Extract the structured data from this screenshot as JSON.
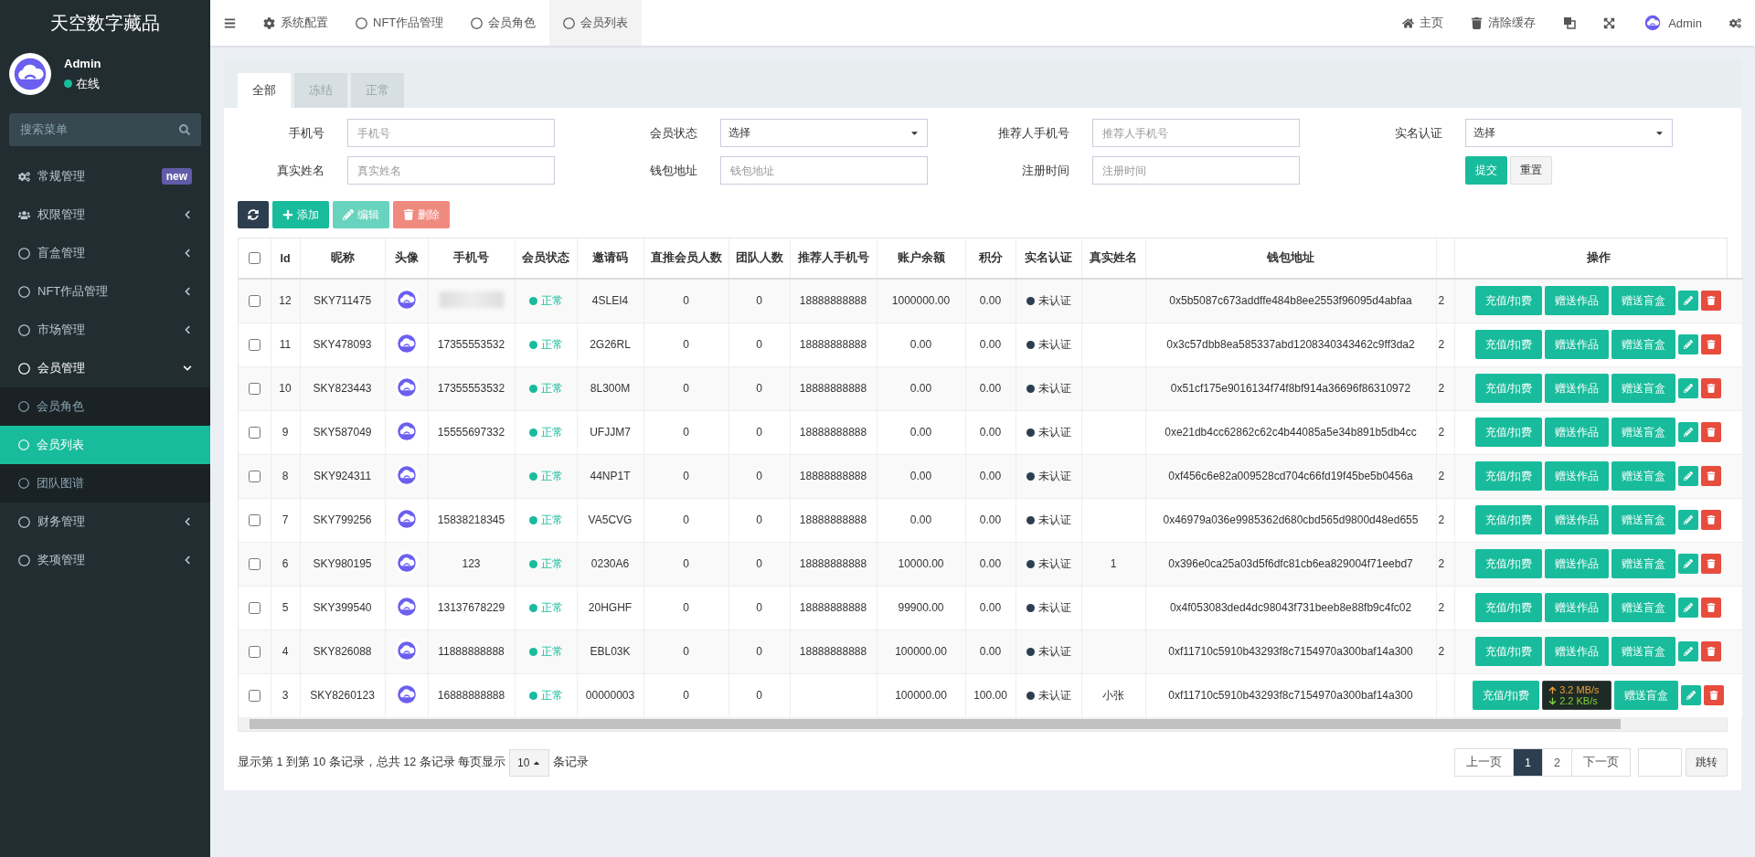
{
  "sidebar": {
    "brand": "天空数字藏品",
    "user": {
      "name": "Admin",
      "status": "在线"
    },
    "search": {
      "placeholder": "搜索菜单"
    },
    "items": [
      {
        "kind": "gears",
        "label": "常规管理",
        "badge": "new",
        "expanded": false,
        "selected": false
      },
      {
        "kind": "users",
        "label": "权限管理",
        "expanded": false,
        "selected": false
      },
      {
        "kind": "circle",
        "label": "盲盒管理",
        "expanded": false,
        "selected": false
      },
      {
        "kind": "circle",
        "label": "NFT作品管理",
        "expanded": false,
        "selected": false
      },
      {
        "kind": "circle",
        "label": "市场管理",
        "expanded": false,
        "selected": false
      },
      {
        "kind": "circle",
        "label": "会员管理",
        "expanded": true,
        "selected": false,
        "children": [
          {
            "label": "会员角色",
            "selected": false
          },
          {
            "label": "会员列表",
            "selected": true
          },
          {
            "label": "团队图谱",
            "selected": false
          }
        ]
      },
      {
        "kind": "circle",
        "label": "财务管理",
        "expanded": false,
        "selected": false
      },
      {
        "kind": "circle",
        "label": "奖项管理",
        "expanded": false,
        "selected": false
      }
    ]
  },
  "topbar": {
    "tabs": [
      {
        "kind": "gear",
        "label": "系统配置",
        "selected": false
      },
      {
        "kind": "circle",
        "label": "NFT作品管理",
        "selected": false
      },
      {
        "kind": "circle",
        "label": "会员角色",
        "selected": false
      },
      {
        "kind": "circle",
        "label": "会员列表",
        "selected": true
      }
    ],
    "right": [
      {
        "kind": "home",
        "label": "主页"
      },
      {
        "kind": "trash",
        "label": "清除缓存"
      },
      {
        "kind": "translate"
      },
      {
        "kind": "fullscreen"
      },
      {
        "kind": "user",
        "label": "Admin"
      },
      {
        "kind": "settings"
      }
    ]
  },
  "filter_tabs": [
    {
      "label": "全部",
      "selected": true
    },
    {
      "label": "冻结",
      "selected": false
    },
    {
      "label": "正常",
      "selected": false
    }
  ],
  "filters": [
    {
      "kind": "text",
      "label": "手机号",
      "placeholder": "手机号"
    },
    {
      "kind": "select",
      "label": "会员状态",
      "value": "选择"
    },
    {
      "kind": "text",
      "label": "推荐人手机号",
      "placeholder": "推荐人手机号"
    },
    {
      "kind": "select",
      "label": "实名认证",
      "value": "选择"
    },
    {
      "kind": "text",
      "label": "真实姓名",
      "placeholder": "真实姓名"
    },
    {
      "kind": "text",
      "label": "钱包地址",
      "placeholder": "钱包地址"
    },
    {
      "kind": "text",
      "label": "注册时间",
      "placeholder": "注册时间"
    }
  ],
  "filter_buttons": [
    "提交",
    "重置"
  ],
  "toolbar": [
    {
      "kind": "refresh",
      "disabled": false
    },
    {
      "kind": "add",
      "label": "添加",
      "disabled": false
    },
    {
      "kind": "edit",
      "label": "编辑",
      "disabled": true
    },
    {
      "kind": "delete",
      "label": "删除",
      "disabled": true
    }
  ],
  "table": {
    "select_all_checked": false,
    "columns": [
      "Id",
      "昵称",
      "头像",
      "手机号",
      "会员状态",
      "邀请码",
      "直推会员人数",
      "团队人数",
      "推荐人手机号",
      "账户余额",
      "积分",
      "实名认证",
      "真实姓名",
      "钱包地址",
      "操作"
    ],
    "rows": [
      {
        "checked": false,
        "id": "12",
        "nickname": "SKY711475",
        "phone_blurred": true,
        "status": "正常",
        "invite_code": "4SLEI4",
        "direct": "0",
        "team": "0",
        "referrer": "18888888888",
        "balance": "1000000.00",
        "points": "0.00",
        "auth": "未认证",
        "wallet": "0x5b5087c673addffe484b8ee2553f96095d4abfaa",
        "column_13": "2",
        "actions": [
          "充值/扣费",
          "赠送作品",
          "赠送盲盒"
        ]
      },
      {
        "checked": false,
        "id": "11",
        "nickname": "SKY478093",
        "phone": "17355553532",
        "phone_blurred": false,
        "status": "正常",
        "invite_code": "2G26RL",
        "direct": "0",
        "team": "0",
        "referrer": "18888888888",
        "balance": "0.00",
        "points": "0.00",
        "auth": "未认证",
        "wallet": "0x3c57dbb8ea585337abd1208340343462c9ff3da2",
        "column_13": "2",
        "actions": [
          "充值/扣费",
          "赠送作品",
          "赠送盲盒"
        ]
      },
      {
        "checked": false,
        "id": "10",
        "nickname": "SKY823443",
        "phone": "17355553532",
        "phone_blurred": false,
        "status": "正常",
        "invite_code": "8L300M",
        "direct": "0",
        "team": "0",
        "referrer": "18888888888",
        "balance": "0.00",
        "points": "0.00",
        "auth": "未认证",
        "wallet": "0x51cf175e9016134f74f8bf914a36696f86310972",
        "column_13": "2",
        "actions": [
          "充值/扣费",
          "赠送作品",
          "赠送盲盒"
        ]
      },
      {
        "checked": false,
        "id": "9",
        "nickname": "SKY587049",
        "phone": "15555697332",
        "phone_blurred": false,
        "status": "正常",
        "invite_code": "UFJJM7",
        "direct": "0",
        "team": "0",
        "referrer": "18888888888",
        "balance": "0.00",
        "points": "0.00",
        "auth": "未认证",
        "wallet": "0xe21db4cc62862c62c4b44085a5e34b891b5db4cc",
        "column_13": "2",
        "actions": [
          "充值/扣费",
          "赠送作品",
          "赠送盲盒"
        ]
      },
      {
        "checked": false,
        "id": "8",
        "nickname": "SKY924311",
        "phone_blurred": false,
        "status": "正常",
        "invite_code": "44NP1T",
        "direct": "0",
        "team": "0",
        "referrer": "18888888888",
        "balance": "0.00",
        "points": "0.00",
        "auth": "未认证",
        "wallet": "0xf456c6e82a009528cd704c66fd19f45be5b0456a",
        "column_13": "2",
        "actions": [
          "充值/扣费",
          "赠送作品",
          "赠送盲盒"
        ]
      },
      {
        "checked": false,
        "id": "7",
        "nickname": "SKY799256",
        "phone": "15838218345",
        "phone_blurred": false,
        "status": "正常",
        "invite_code": "VA5CVG",
        "direct": "0",
        "team": "0",
        "referrer": "18888888888",
        "balance": "0.00",
        "points": "0.00",
        "auth": "未认证",
        "wallet": "0x46979a036e9985362d680cbd565d9800d48ed655",
        "column_13": "2",
        "actions": [
          "充值/扣费",
          "赠送作品",
          "赠送盲盒"
        ]
      },
      {
        "checked": false,
        "id": "6",
        "nickname": "SKY980195",
        "phone": "123",
        "phone_blurred": false,
        "status": "正常",
        "invite_code": "0230A6",
        "direct": "0",
        "team": "0",
        "referrer": "18888888888",
        "balance": "10000.00",
        "points": "0.00",
        "auth": "未认证",
        "real_name": "1",
        "wallet": "0x396e0ca25a03d5f6dfc81cb6ea829004f71eebd7",
        "column_13": "2",
        "actions": [
          "充值/扣费",
          "赠送作品",
          "赠送盲盒"
        ]
      },
      {
        "checked": false,
        "id": "5",
        "nickname": "SKY399540",
        "phone": "13137678229",
        "phone_blurred": false,
        "status": "正常",
        "invite_code": "20HGHF",
        "direct": "0",
        "team": "0",
        "referrer": "18888888888",
        "balance": "99900.00",
        "points": "0.00",
        "auth": "未认证",
        "wallet": "0x4f053083ded4dc98043f731beeb8e88fb9c4fc02",
        "column_13": "2",
        "actions": [
          "充值/扣费",
          "赠送作品",
          "赠送盲盒"
        ]
      },
      {
        "checked": false,
        "id": "4",
        "nickname": "SKY826088",
        "phone": "11888888888",
        "phone_blurred": false,
        "status": "正常",
        "invite_code": "EBL03K",
        "direct": "0",
        "team": "0",
        "referrer": "18888888888",
        "balance": "100000.00",
        "points": "0.00",
        "auth": "未认证",
        "wallet": "0xf11710c5910b43293f8c7154970a300baf14a300",
        "column_13": "2",
        "actions": [
          "充值/扣费",
          "赠送作品",
          "赠送盲盒"
        ]
      },
      {
        "checked": false,
        "id": "3",
        "nickname": "SKY8260123",
        "phone": "16888888888",
        "phone_blurred": false,
        "status": "正常",
        "invite_code": "00000003",
        "direct": "0",
        "team": "0",
        "balance": "100000.00",
        "points": "100.00",
        "auth": "未认证",
        "real_name": "小张",
        "wallet": "0xf11710c5910b43293f8c7154970a300baf14a300",
        "actions": [
          "充值/扣费",
          "赠送盲盒"
        ],
        "speed_overlay": {
          "up": "3.2 MB/s",
          "down": "2.2 KB/s"
        }
      }
    ]
  },
  "footer": {
    "summary": "显示第 1 到第 10 条记录，总共 12 条记录 每页显示",
    "page_size": "10",
    "suffix": "条记录",
    "pages": [
      {
        "label": "上一页",
        "selected": false
      },
      {
        "label": "1",
        "selected": true
      },
      {
        "label": "2",
        "selected": false
      },
      {
        "label": "下一页",
        "selected": false
      }
    ],
    "jump": "跳转"
  }
}
